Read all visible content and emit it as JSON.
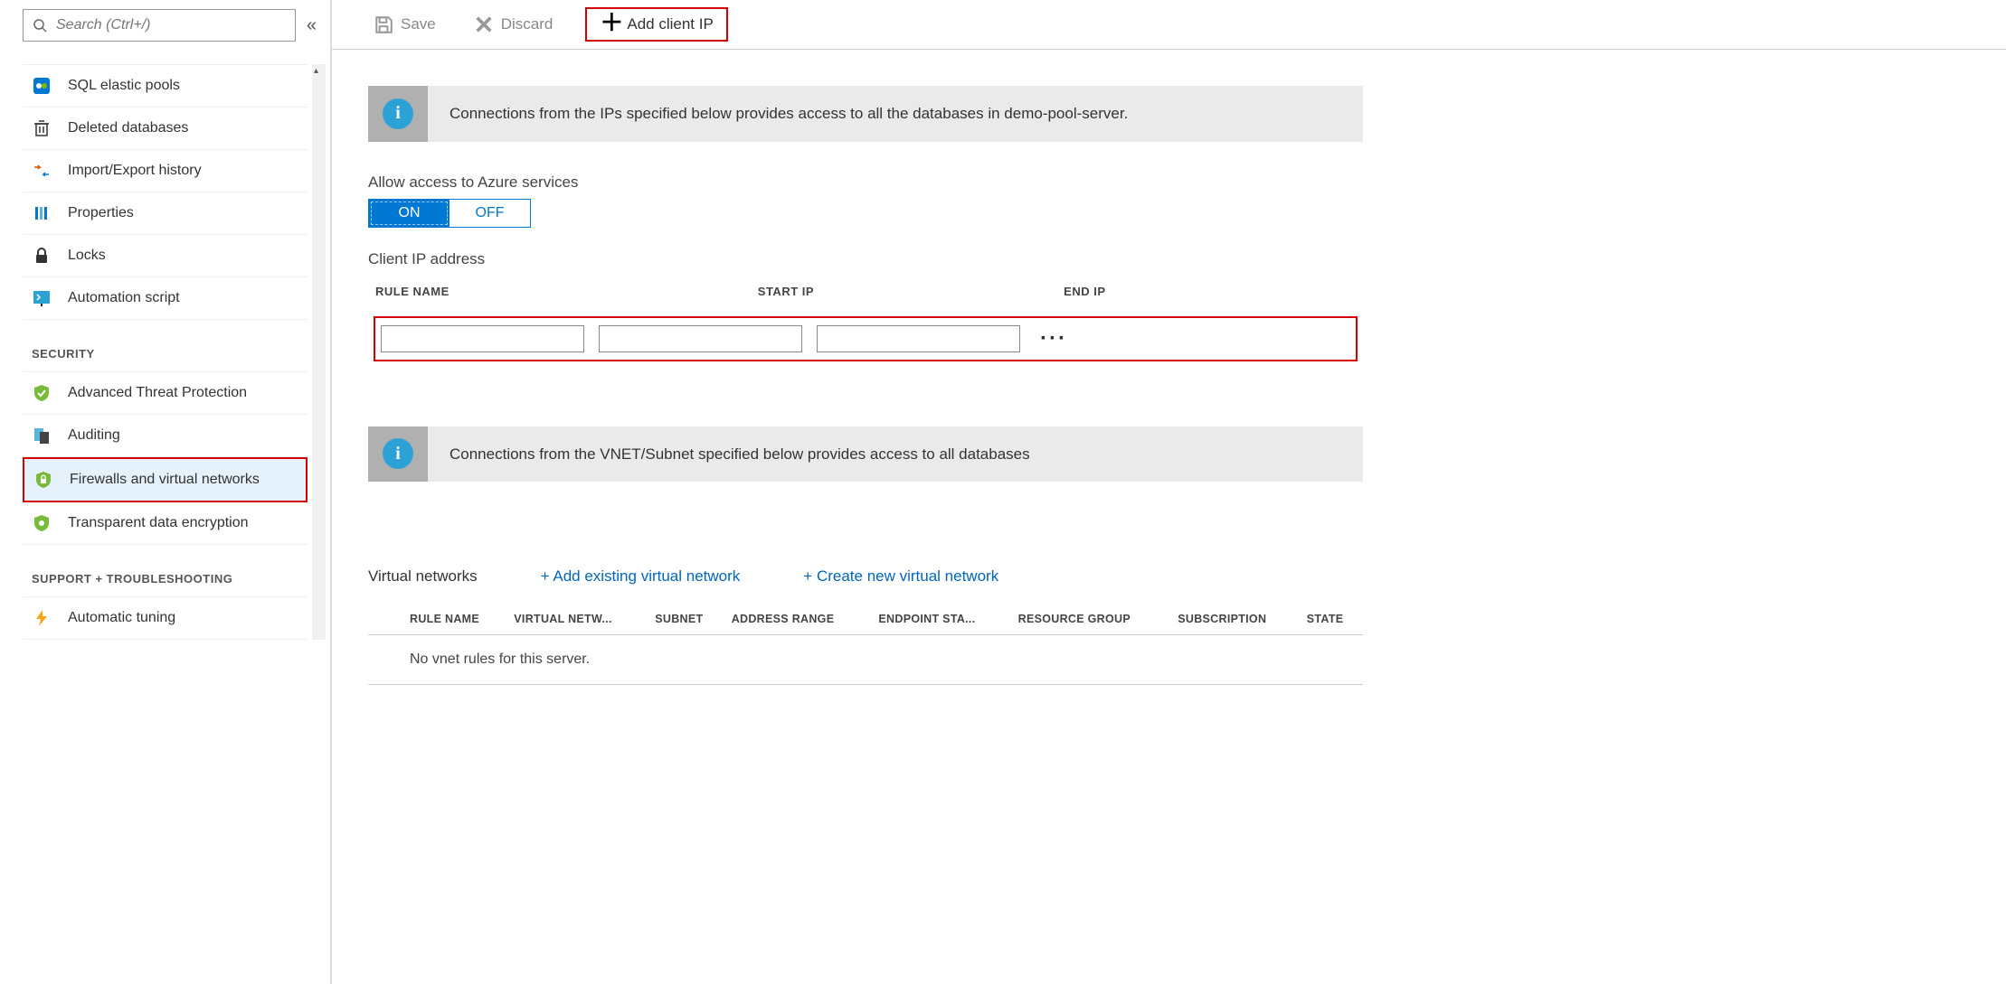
{
  "sidebar": {
    "search_placeholder": "Search (Ctrl+/)",
    "items": [
      {
        "label": "SQL elastic pools"
      },
      {
        "label": "Deleted databases"
      },
      {
        "label": "Import/Export history"
      },
      {
        "label": "Properties"
      },
      {
        "label": "Locks"
      },
      {
        "label": "Automation script"
      }
    ],
    "section_security": "SECURITY",
    "security_items": [
      {
        "label": "Advanced Threat Protection"
      },
      {
        "label": "Auditing"
      },
      {
        "label": "Firewalls and virtual networks"
      },
      {
        "label": "Transparent data encryption"
      }
    ],
    "section_support": "SUPPORT + TROUBLESHOOTING",
    "support_items": [
      {
        "label": "Automatic tuning"
      }
    ]
  },
  "toolbar": {
    "save": "Save",
    "discard": "Discard",
    "add_client_ip": "Add client IP"
  },
  "content": {
    "banner1": "Connections from the IPs specified below provides access to all the databases in demo-pool-server.",
    "allow_label": "Allow access to Azure services",
    "toggle_on": "ON",
    "toggle_off": "OFF",
    "client_ip_label": "Client IP address",
    "cols": {
      "rule": "RULE NAME",
      "start": "START IP",
      "end": "END IP"
    },
    "banner2": "Connections from the VNET/Subnet specified below provides access to all databases",
    "vnet_title": "Virtual networks",
    "add_existing": "+ Add existing virtual network",
    "create_new": "+ Create new virtual network",
    "vnet_cols": {
      "rule": "RULE NAME",
      "vnet": "VIRTUAL NETW...",
      "subnet": "SUBNET",
      "addr": "ADDRESS RANGE",
      "endpoint": "ENDPOINT STA...",
      "rg": "RESOURCE GROUP",
      "sub": "SUBSCRIPTION",
      "state": "STATE"
    },
    "no_vnet": "No vnet rules for this server."
  }
}
